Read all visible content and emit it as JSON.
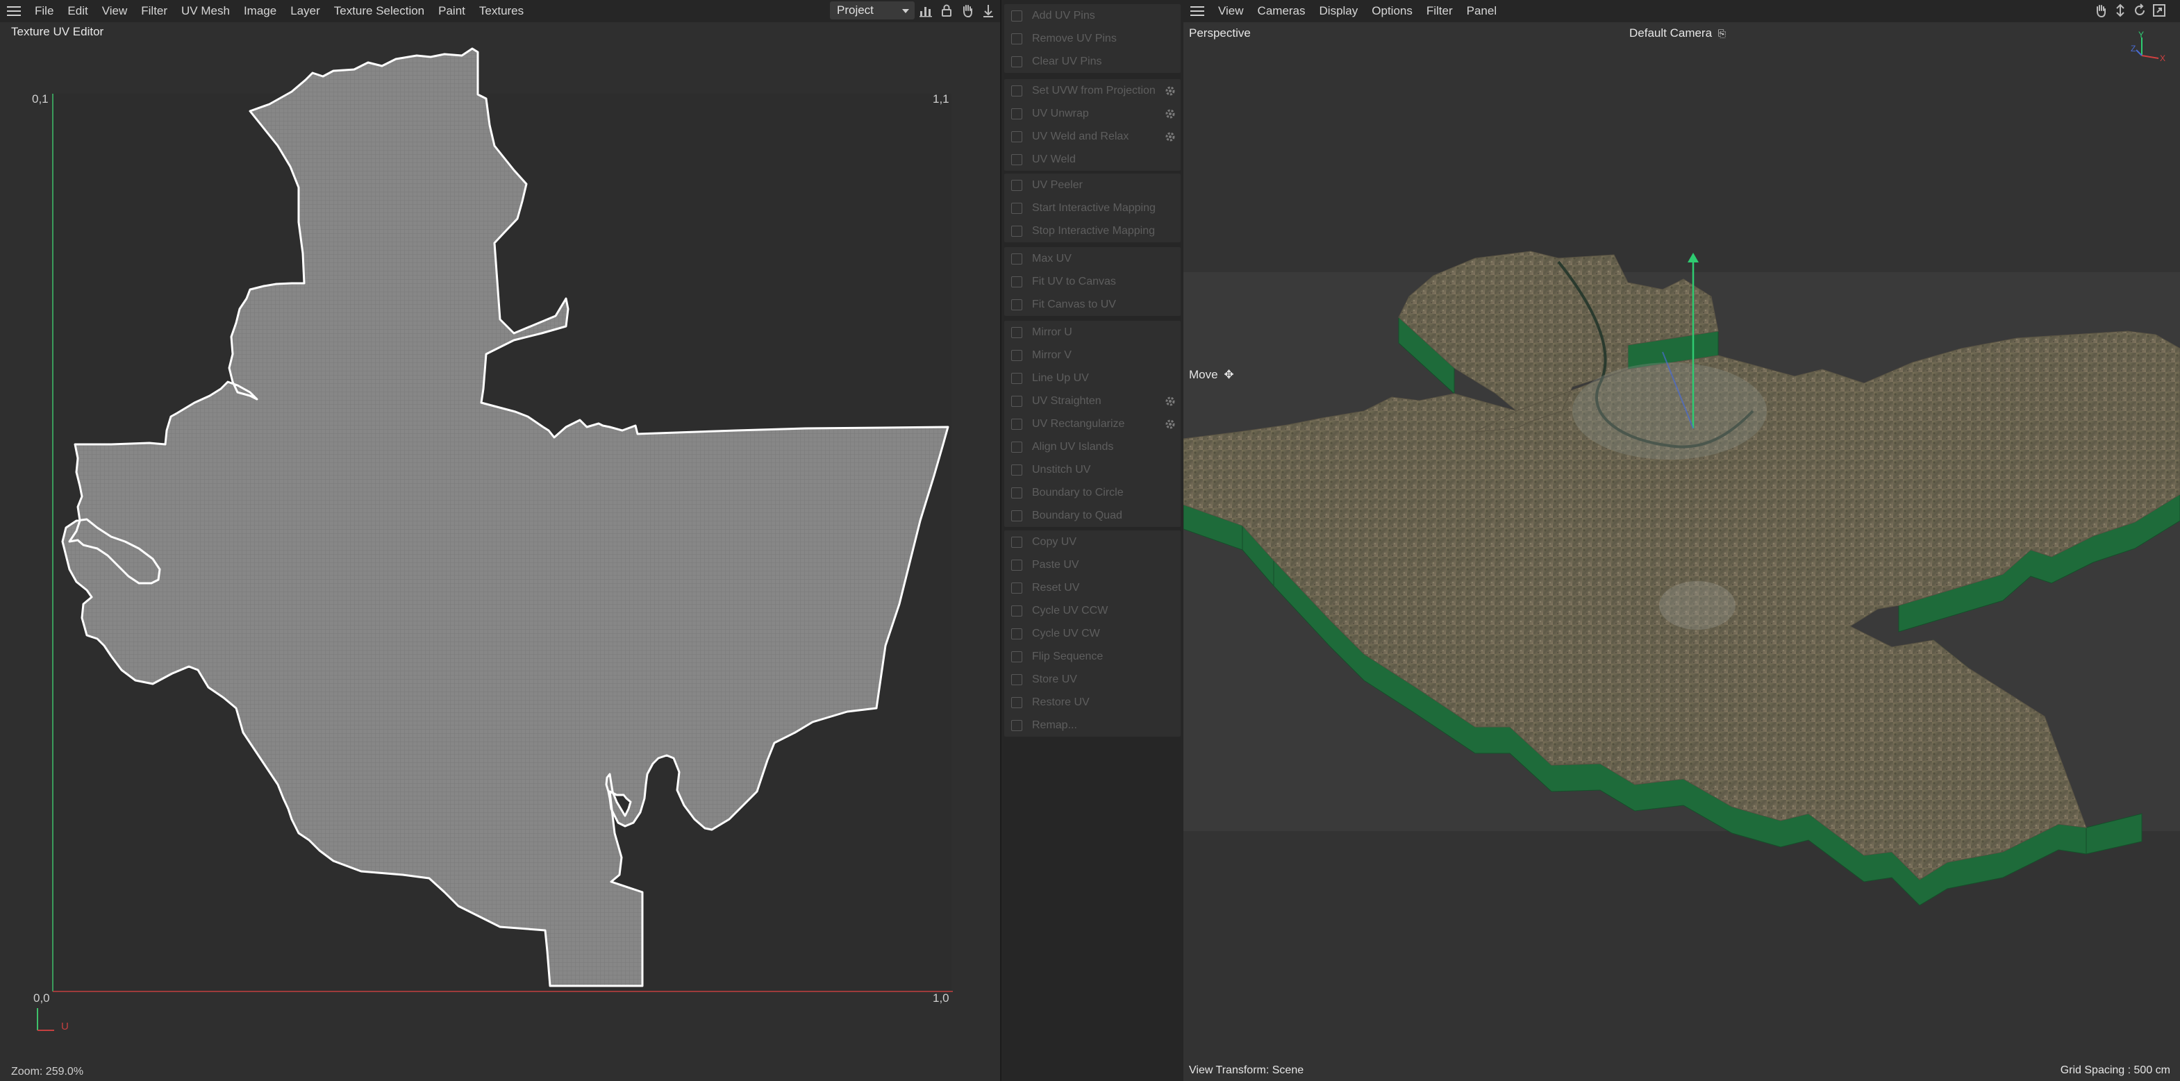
{
  "uv_editor": {
    "menu": [
      "File",
      "Edit",
      "View",
      "Filter",
      "UV Mesh",
      "Image",
      "Layer",
      "Texture Selection",
      "Paint",
      "Textures"
    ],
    "title": "Texture UV Editor",
    "dropdown_value": "Project",
    "corner_labels": {
      "top_left": "0,1",
      "top_right": "1,1",
      "bottom_left": "0,0",
      "bottom_right": "1,0"
    },
    "axis_u": "U",
    "zoom": "Zoom: 259.0%",
    "colors": {
      "island_fill": "#8a8a8a",
      "island_outline": "#ffffff",
      "u_axis": "#c44040",
      "v_axis": "#3ec06a"
    }
  },
  "commands": {
    "groups": [
      [
        {
          "label": "Add UV Pins",
          "icon": "pin-add-icon"
        },
        {
          "label": "Remove UV Pins",
          "icon": "pin-remove-icon"
        },
        {
          "label": "Clear UV Pins",
          "icon": "clear-icon"
        }
      ],
      [
        {
          "label": "Set UVW from Projection",
          "icon": "projection-icon",
          "gear": true
        },
        {
          "label": "UV Unwrap",
          "icon": "unwrap-icon",
          "gear": true
        },
        {
          "label": "UV Weld and Relax",
          "icon": "weld-relax-icon",
          "gear": true
        },
        {
          "label": "UV Weld",
          "icon": "weld-icon"
        }
      ],
      [
        {
          "label": "UV Peeler",
          "icon": "peeler-icon"
        },
        {
          "label": "Start Interactive Mapping",
          "icon": "play-icon"
        },
        {
          "label": "Stop Interactive Mapping",
          "icon": "stop-icon"
        }
      ],
      [
        {
          "label": "Max UV",
          "icon": "max-uv-icon"
        },
        {
          "label": "Fit UV to Canvas",
          "icon": "fit-uv-icon"
        },
        {
          "label": "Fit Canvas to UV",
          "icon": "fit-canvas-icon"
        }
      ],
      [
        {
          "label": "Mirror U",
          "icon": "mirror-u-icon"
        },
        {
          "label": "Mirror V",
          "icon": "mirror-v-icon"
        },
        {
          "label": "Line Up UV",
          "icon": "line-up-icon"
        },
        {
          "label": "UV Straighten",
          "icon": "straighten-icon",
          "gear": true
        },
        {
          "label": "UV Rectangularize",
          "icon": "rectangularize-icon",
          "gear": true
        },
        {
          "label": "Align UV Islands",
          "icon": "align-icon"
        },
        {
          "label": "Unstitch UV",
          "icon": "unstitch-icon"
        },
        {
          "label": "Boundary to Circle",
          "icon": "circle-icon"
        },
        {
          "label": "Boundary to Quad",
          "icon": "quad-icon"
        }
      ],
      [
        {
          "label": "Copy UV",
          "icon": "copy-icon"
        },
        {
          "label": "Paste UV",
          "icon": "paste-icon"
        },
        {
          "label": "Reset UV",
          "icon": "reset-icon"
        },
        {
          "label": "Cycle UV CCW",
          "icon": "ccw-icon"
        },
        {
          "label": "Cycle UV CW",
          "icon": "cw-icon"
        },
        {
          "label": "Flip Sequence",
          "icon": "flip-icon"
        },
        {
          "label": "Store UV",
          "icon": "store-icon"
        },
        {
          "label": "Restore UV",
          "icon": "restore-icon"
        },
        {
          "label": "Remap...",
          "icon": "remap-icon"
        }
      ]
    ]
  },
  "viewport": {
    "menu": [
      "View",
      "Cameras",
      "Display",
      "Options",
      "Filter",
      "Panel"
    ],
    "view_name": "Perspective",
    "camera": "Default Camera",
    "tool": "Move",
    "view_transform": "View Transform: Scene",
    "grid_spacing": "Grid Spacing : 500 cm",
    "colors": {
      "terrain": "#6b6450",
      "terrain_side": "#1f6a3c",
      "y_axis": "#2ecc71"
    }
  }
}
